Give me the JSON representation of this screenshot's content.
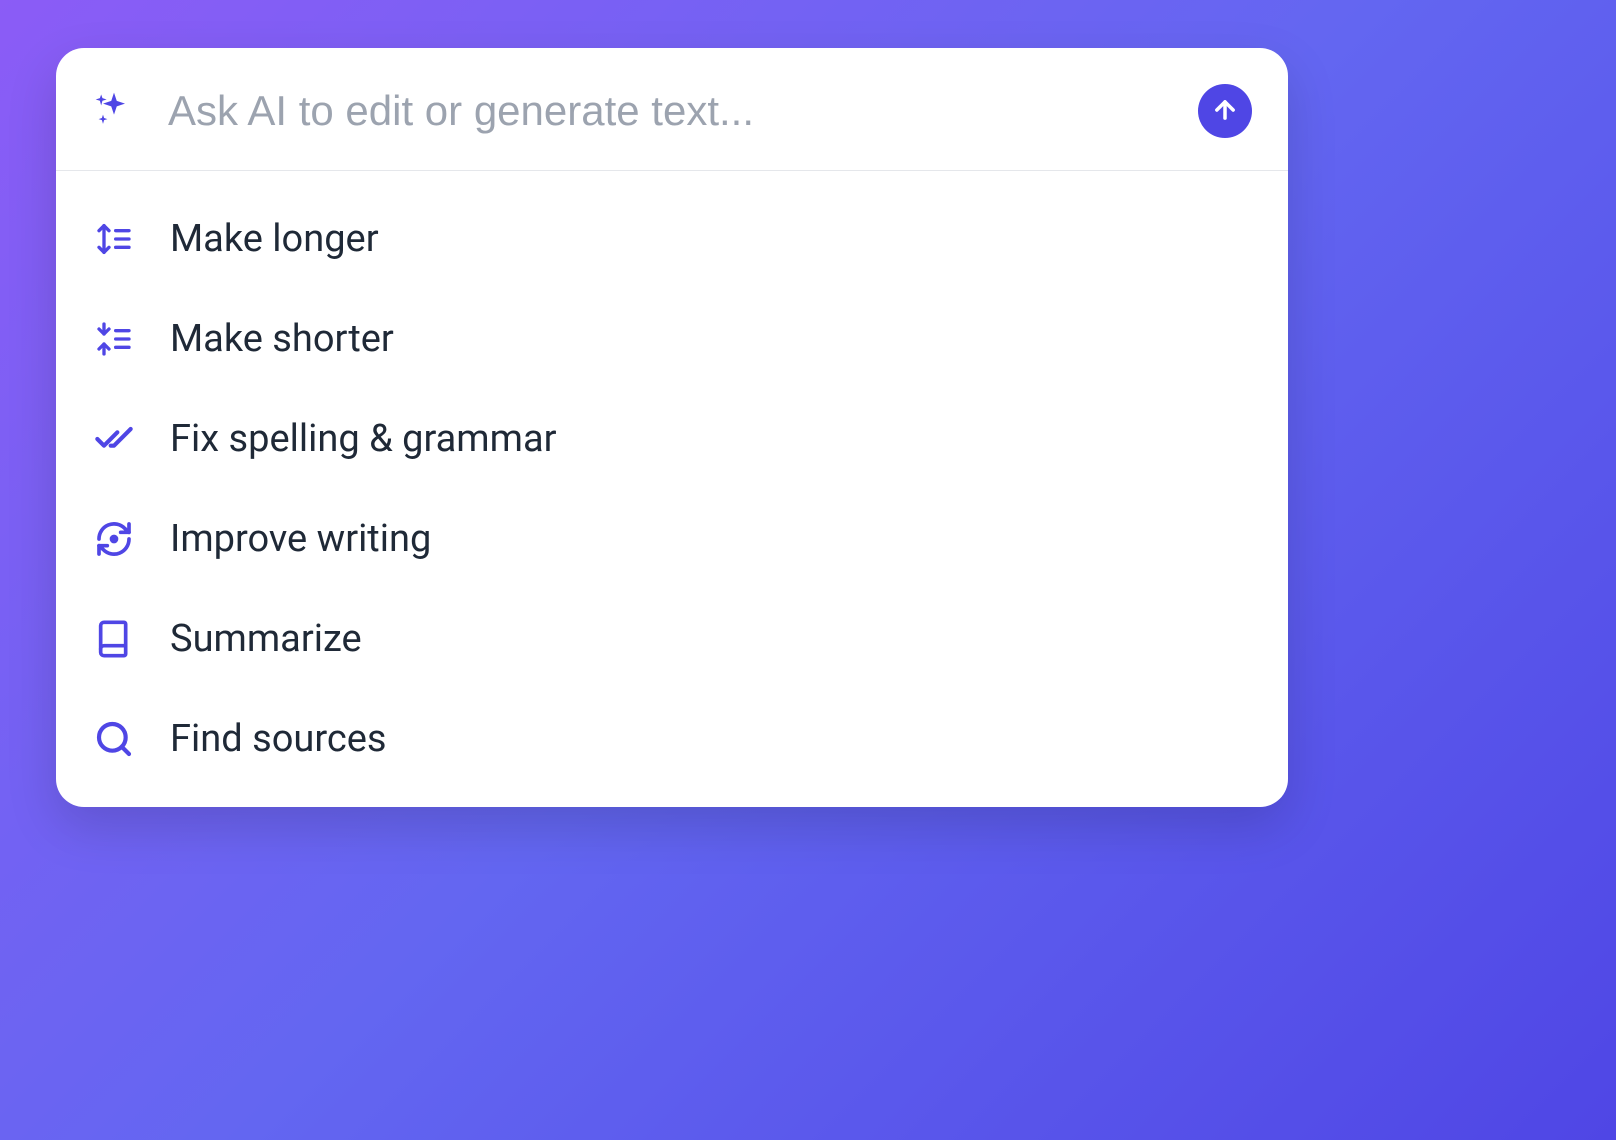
{
  "colors": {
    "accent": "#4F46E5",
    "icon": "#4F46E5",
    "text": "#1f2937",
    "placeholder": "#9ca3af"
  },
  "input": {
    "placeholder": "Ask AI to edit or generate text...",
    "value": ""
  },
  "menu": {
    "items": [
      {
        "icon": "expand-lines-icon",
        "label": "Make longer"
      },
      {
        "icon": "collapse-lines-icon",
        "label": "Make shorter"
      },
      {
        "icon": "double-check-icon",
        "label": "Fix spelling & grammar"
      },
      {
        "icon": "refresh-icon",
        "label": "Improve writing"
      },
      {
        "icon": "book-icon",
        "label": "Summarize"
      },
      {
        "icon": "search-icon",
        "label": "Find sources"
      }
    ]
  }
}
